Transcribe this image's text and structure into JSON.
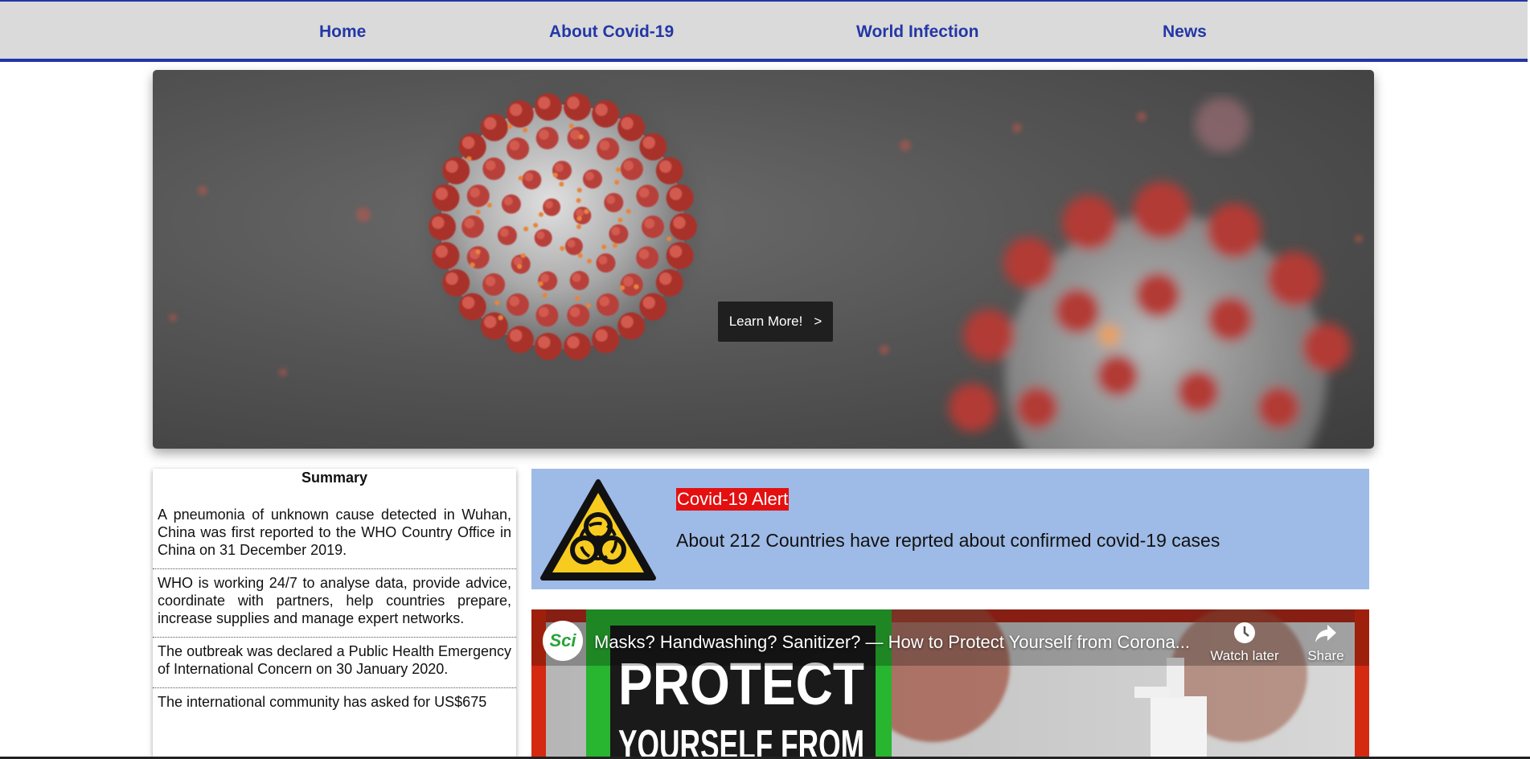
{
  "nav": {
    "items": [
      {
        "label": "Home"
      },
      {
        "label": "About Covid-19"
      },
      {
        "label": "World Infection"
      },
      {
        "label": "News"
      }
    ],
    "color": "#2337a6"
  },
  "hero": {
    "button_label": "Learn More!",
    "button_arrow": ">"
  },
  "summary": {
    "title": "Summary",
    "items": [
      "A pneumonia of unknown cause detected in Wuhan, China was first reported to the WHO Country Office in China on 31 December 2019.",
      "WHO is working 24/7 to analyse data, provide advice, coordinate with partners, help countries prepare, increase supplies and manage expert networks.",
      "The outbreak was declared a Public Health Emergency of International Concern on 30 January 2020.",
      "The international community has asked for US$675"
    ]
  },
  "alert": {
    "icon": "biohazard-icon",
    "title": "Covid-19 Alert",
    "text": "About 212 Countries have reprted about confirmed covid-19 cases",
    "background": "#9ebae6",
    "title_background": "#e41010"
  },
  "video": {
    "channel_logo_text": "Sci",
    "title": "Masks? Handwashing? Sanitizer? — How to Protect Yourself from Corona...",
    "watch_later_label": "Watch later",
    "share_label": "Share",
    "thumbnail_text_line1": "PROTECT",
    "thumbnail_text_line2": "YOURSELF FROM"
  }
}
